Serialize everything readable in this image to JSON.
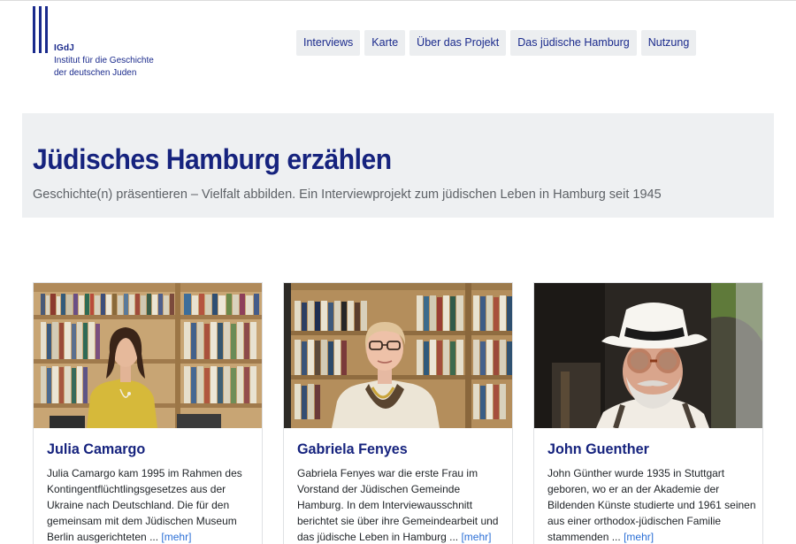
{
  "logo": {
    "abbr": "IGdJ",
    "line1": "Institut für die Geschichte",
    "line2": "der deutschen Juden"
  },
  "nav": {
    "items": [
      {
        "label": "Interviews"
      },
      {
        "label": "Karte"
      },
      {
        "label": "Über das Projekt"
      },
      {
        "label": "Das jüdische Hamburg"
      },
      {
        "label": "Nutzung"
      }
    ]
  },
  "hero": {
    "title": "Jüdisches Hamburg erzählen",
    "subtitle": "Geschichte(n) präsentieren – Vielfalt abbilden. Ein Interviewprojekt zum jüdischen Leben in Hamburg seit 1945"
  },
  "cards": [
    {
      "name": "Julia Camargo",
      "text": "Julia Camargo kam 1995 im Rahmen des Kontingentflüchtlingsgesetzes aus der Ukraine nach Deutschland. Die für den gemeinsam mit dem Jüdischen Museum Berlin ausgerichteten ...",
      "more": "[mehr]"
    },
    {
      "name": "Gabriela Fenyes",
      "text": "Gabriela Fenyes war die erste Frau im Vorstand der Jüdischen Gemeinde Hamburg. In dem Interviewausschnitt berichtet sie über ihre Gemeindearbeit und das jüdische Leben in Hamburg ...",
      "more": "[mehr]"
    },
    {
      "name": "John Guenther",
      "text": "John Günther wurde 1935 in Stuttgart geboren, wo er an der Akademie der Bildenden Künste studierte und 1961 seinen aus einer orthodox-jüdischen Familie stammenden ...",
      "more": "[mehr]"
    }
  ],
  "colors": {
    "brand_blue": "#16237e",
    "link_blue": "#2b6fd6",
    "hero_bg": "#eef0f2",
    "nav_bg": "#eceef0"
  }
}
